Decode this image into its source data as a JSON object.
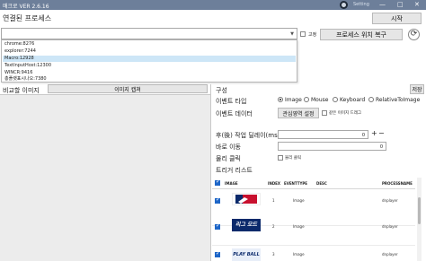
{
  "window": {
    "title": "매크로 VER 2.6.16",
    "setting_label": "Setting",
    "minimize": "—",
    "maximize": "□",
    "close": "✕"
  },
  "process": {
    "label": "연결된 프로세스",
    "start_button": "시작",
    "fixed_label": "고정",
    "restore_button": "프로세스 위치 복구",
    "refresh_symbol": "⟳",
    "dropdown_items": [
      "chrome:8276",
      "explorer:7244",
      "Macro:12928",
      "TextInputHost:12300",
      "WINCR:9416",
      "총플랫표시나오:7380"
    ],
    "selected_index": 2
  },
  "compare": {
    "label": "비교할 이미지",
    "capture_button": "이미지 캡쳐"
  },
  "config": {
    "label": "구성",
    "save_button": "저장",
    "event_type_label": "이벤트 타입",
    "event_types": [
      "Image",
      "Mouse",
      "Keyboard",
      "RelativeToImage"
    ],
    "selected_event_type": 0,
    "event_data_label": "이벤트 데이터",
    "roi_button": "관심영역 설정",
    "same_image_drag": "같은 이미지 드래그",
    "delay_label": "후(後) 작업 딜레이(ms)",
    "delay_value": "0",
    "go_label": "바로 이동",
    "go_value": "0",
    "physical_click_label": "물리 클릭",
    "physical_click_option": "물리 클릭",
    "trigger_label": "트리거 리스트"
  },
  "table": {
    "headers": [
      "IMAGE",
      "INDEX",
      "EVENTTYPE",
      "DESC",
      "PROCESSNAME"
    ],
    "rows": [
      {
        "index": "1",
        "eventtype": "Image",
        "desc": "",
        "process": "dnplayer",
        "checked": true,
        "thumb": "logo"
      },
      {
        "index": "2",
        "eventtype": "Image",
        "desc": "",
        "process": "dnplayer",
        "checked": true,
        "thumb": "리그 모드"
      },
      {
        "index": "3",
        "eventtype": "Image",
        "desc": "",
        "process": "dnplayer",
        "checked": true,
        "thumb": "PLAY BALL"
      }
    ]
  },
  "colors": {
    "titlebar": "#6d7f9a",
    "thumb_red": "#c8102e",
    "thumb_navy": "#0b2a6b"
  }
}
